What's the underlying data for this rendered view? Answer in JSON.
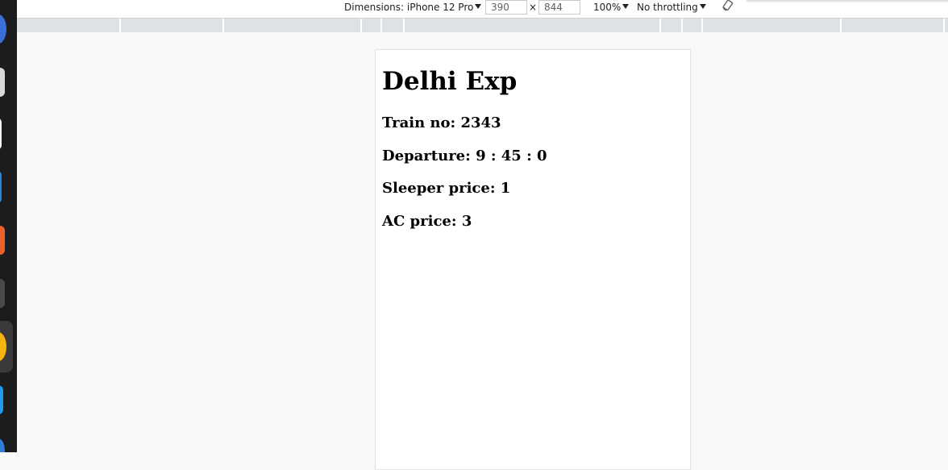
{
  "toolbar": {
    "dimensions_label": "Dimensions: iPhone 12 Pro",
    "width_value": "390",
    "times": "×",
    "height_value": "844",
    "zoom": "100%",
    "throttling": "No throttling"
  },
  "page": {
    "title": "Delhi Exp",
    "details": [
      {
        "label": "Train no:",
        "value": "2343"
      },
      {
        "label": "Departure:",
        "value": "9 : 45 : 0"
      },
      {
        "label": "Sleeper price:",
        "value": "1"
      },
      {
        "label": "AC price:",
        "value": "3"
      }
    ]
  },
  "colors": {
    "dock": "#1c1b1d",
    "media_query_bar": "#dee1e6",
    "page_background": "#f8f9f9"
  }
}
